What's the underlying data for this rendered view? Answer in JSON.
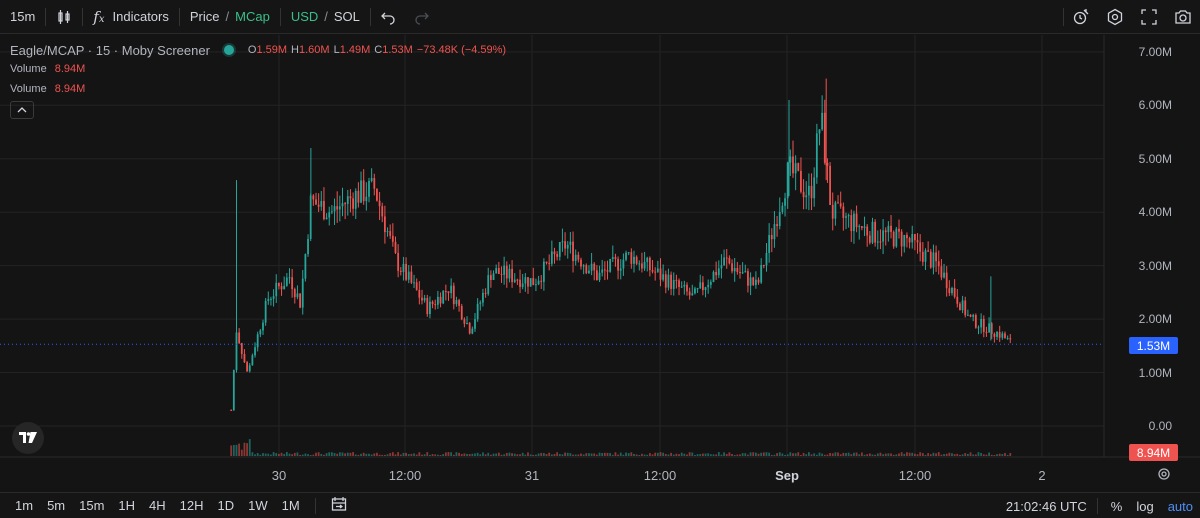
{
  "toolbar": {
    "interval": "15m",
    "indicators_label": "Indicators",
    "price_label": "Price",
    "slash": "/",
    "mcap_label": "MCap",
    "usd_label": "USD",
    "sol_label": "SOL"
  },
  "legend": {
    "title": "Eagle/MCAP · 15 · Moby Screener",
    "o_label": "O",
    "o_value": "1.59M",
    "h_label": "H",
    "h_value": "1.60M",
    "l_label": "L",
    "l_value": "1.49M",
    "c_label": "C",
    "c_value": "1.53M",
    "change": "−73.48K (−4.59%)",
    "volume_label": "Volume",
    "volume_value": "8.94M"
  },
  "price_axis": {
    "labels": [
      "7.00M",
      "6.00M",
      "5.00M",
      "4.00M",
      "3.00M",
      "2.00M",
      "1.00M",
      "0.00"
    ],
    "current_price": "1.53M",
    "current_volume": "8.94M"
  },
  "time_axis": {
    "labels": [
      "30",
      "12:00",
      "31",
      "12:00",
      "Sep",
      "12:00",
      "2"
    ]
  },
  "bottom": {
    "ranges": [
      "1m",
      "5m",
      "15m",
      "1H",
      "4H",
      "12H",
      "1D",
      "1W",
      "1M"
    ],
    "clock": "21:02:46 UTC",
    "percent": "%",
    "log": "log",
    "auto": "auto"
  },
  "colors": {
    "up": "#26a69a",
    "down": "#ef5350",
    "current_price_tag": "#2962ff",
    "volume_tag": "#ef5350",
    "accent": "#3bbf8a"
  },
  "chart_data": {
    "type": "candlestick",
    "title": "Eagle/MCAP · 15 · Moby Screener",
    "interval": "15m",
    "unit": "USD market cap",
    "ylim": [
      0,
      7000000
    ],
    "grid": true,
    "x_ticks": [
      "30",
      "12:00",
      "31",
      "12:00",
      "Sep",
      "12:00",
      "2"
    ],
    "price_trajectory": [
      {
        "t": "Aug 29 19:30",
        "v": 300000
      },
      {
        "t": "Aug 29 20:00",
        "v": 1800000
      },
      {
        "t": "Aug 29 21:00",
        "v": 1000000
      },
      {
        "t": "Aug 29 23:00",
        "v": 2400000
      },
      {
        "t": "Aug 30 01:00",
        "v": 2800000
      },
      {
        "t": "Aug 30 02:00",
        "v": 2300000
      },
      {
        "t": "Aug 30 03:00",
        "v": 4200000
      },
      {
        "t": "Aug 30 05:00",
        "v": 4000000
      },
      {
        "t": "Aug 30 07:00",
        "v": 4300000
      },
      {
        "t": "Aug 30 09:00",
        "v": 4450000
      },
      {
        "t": "Aug 30 11:00",
        "v": 3100000
      },
      {
        "t": "Aug 30 14:00",
        "v": 2200000
      },
      {
        "t": "Aug 30 16:00",
        "v": 2600000
      },
      {
        "t": "Aug 30 18:00",
        "v": 1800000
      },
      {
        "t": "Aug 30 20:00",
        "v": 2900000
      },
      {
        "t": "Aug 31 00:00",
        "v": 2700000
      },
      {
        "t": "Aug 31 03:00",
        "v": 3400000
      },
      {
        "t": "Aug 31 06:00",
        "v": 2800000
      },
      {
        "t": "Aug 31 09:00",
        "v": 3200000
      },
      {
        "t": "Aug 31 12:00",
        "v": 2800000
      },
      {
        "t": "Aug 31 15:00",
        "v": 2400000
      },
      {
        "t": "Aug 31 18:00",
        "v": 3100000
      },
      {
        "t": "Aug 31 21:00",
        "v": 2600000
      },
      {
        "t": "Sep 01 00:00",
        "v": 4800000
      },
      {
        "t": "Sep 01 02:00",
        "v": 4300000
      },
      {
        "t": "Sep 01 03:00",
        "v": 5800000
      },
      {
        "t": "Sep 01 04:00",
        "v": 4000000
      },
      {
        "t": "Sep 01 08:00",
        "v": 3600000
      },
      {
        "t": "Sep 01 11:00",
        "v": 3500000
      },
      {
        "t": "Sep 01 14:00",
        "v": 3000000
      },
      {
        "t": "Sep 01 17:00",
        "v": 2000000
      },
      {
        "t": "Sep 01 20:00",
        "v": 1700000
      },
      {
        "t": "Sep 01 21:00",
        "v": 1530000
      }
    ],
    "last": {
      "open": 1590000,
      "high": 1600000,
      "low": 1490000,
      "close": 1530000,
      "volume": 8940000
    }
  }
}
